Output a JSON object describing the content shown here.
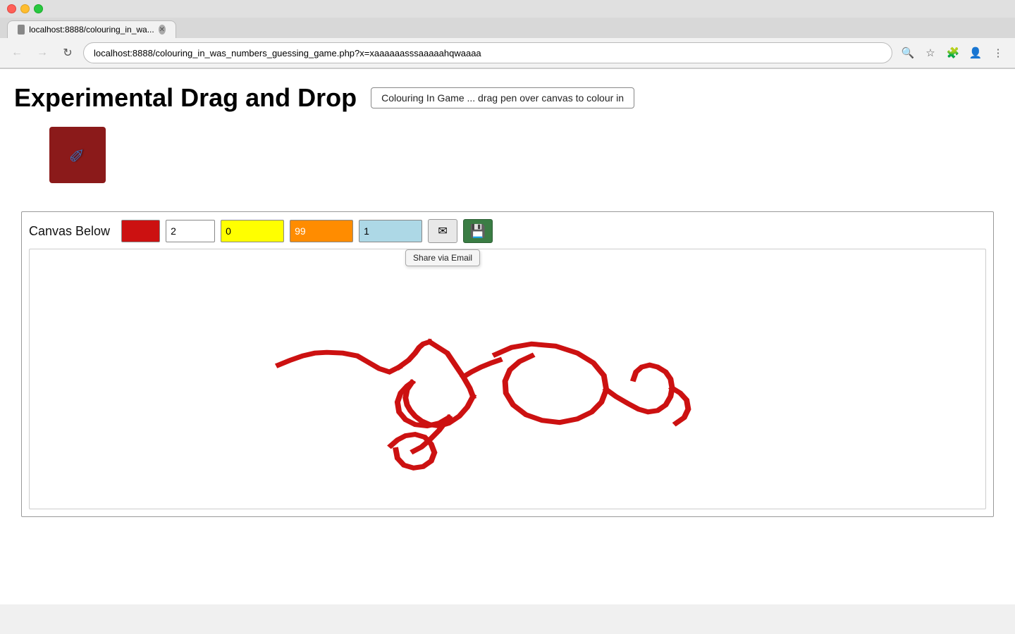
{
  "browser": {
    "url": "localhost:8888/colouring_in_was_numbers_guessing_game.php?x=xaaaaaasssaaaaahqwaaaa",
    "tab_title": "localhost:8888/colouring_in_wa...",
    "traffic_lights": [
      "red",
      "yellow",
      "green"
    ]
  },
  "page": {
    "title": "Experimental Drag and Drop",
    "badge_text": "Colouring In Game ... drag pen over canvas to colour in"
  },
  "controls": {
    "label": "Canvas Below",
    "number1": "2",
    "number2": "0",
    "number3": "99",
    "number4": "1",
    "share_tooltip": "Share via Email"
  },
  "icons": {
    "back": "←",
    "forward": "→",
    "refresh": "↻",
    "pen": "✏",
    "share_email": "✉",
    "save": "💾"
  }
}
